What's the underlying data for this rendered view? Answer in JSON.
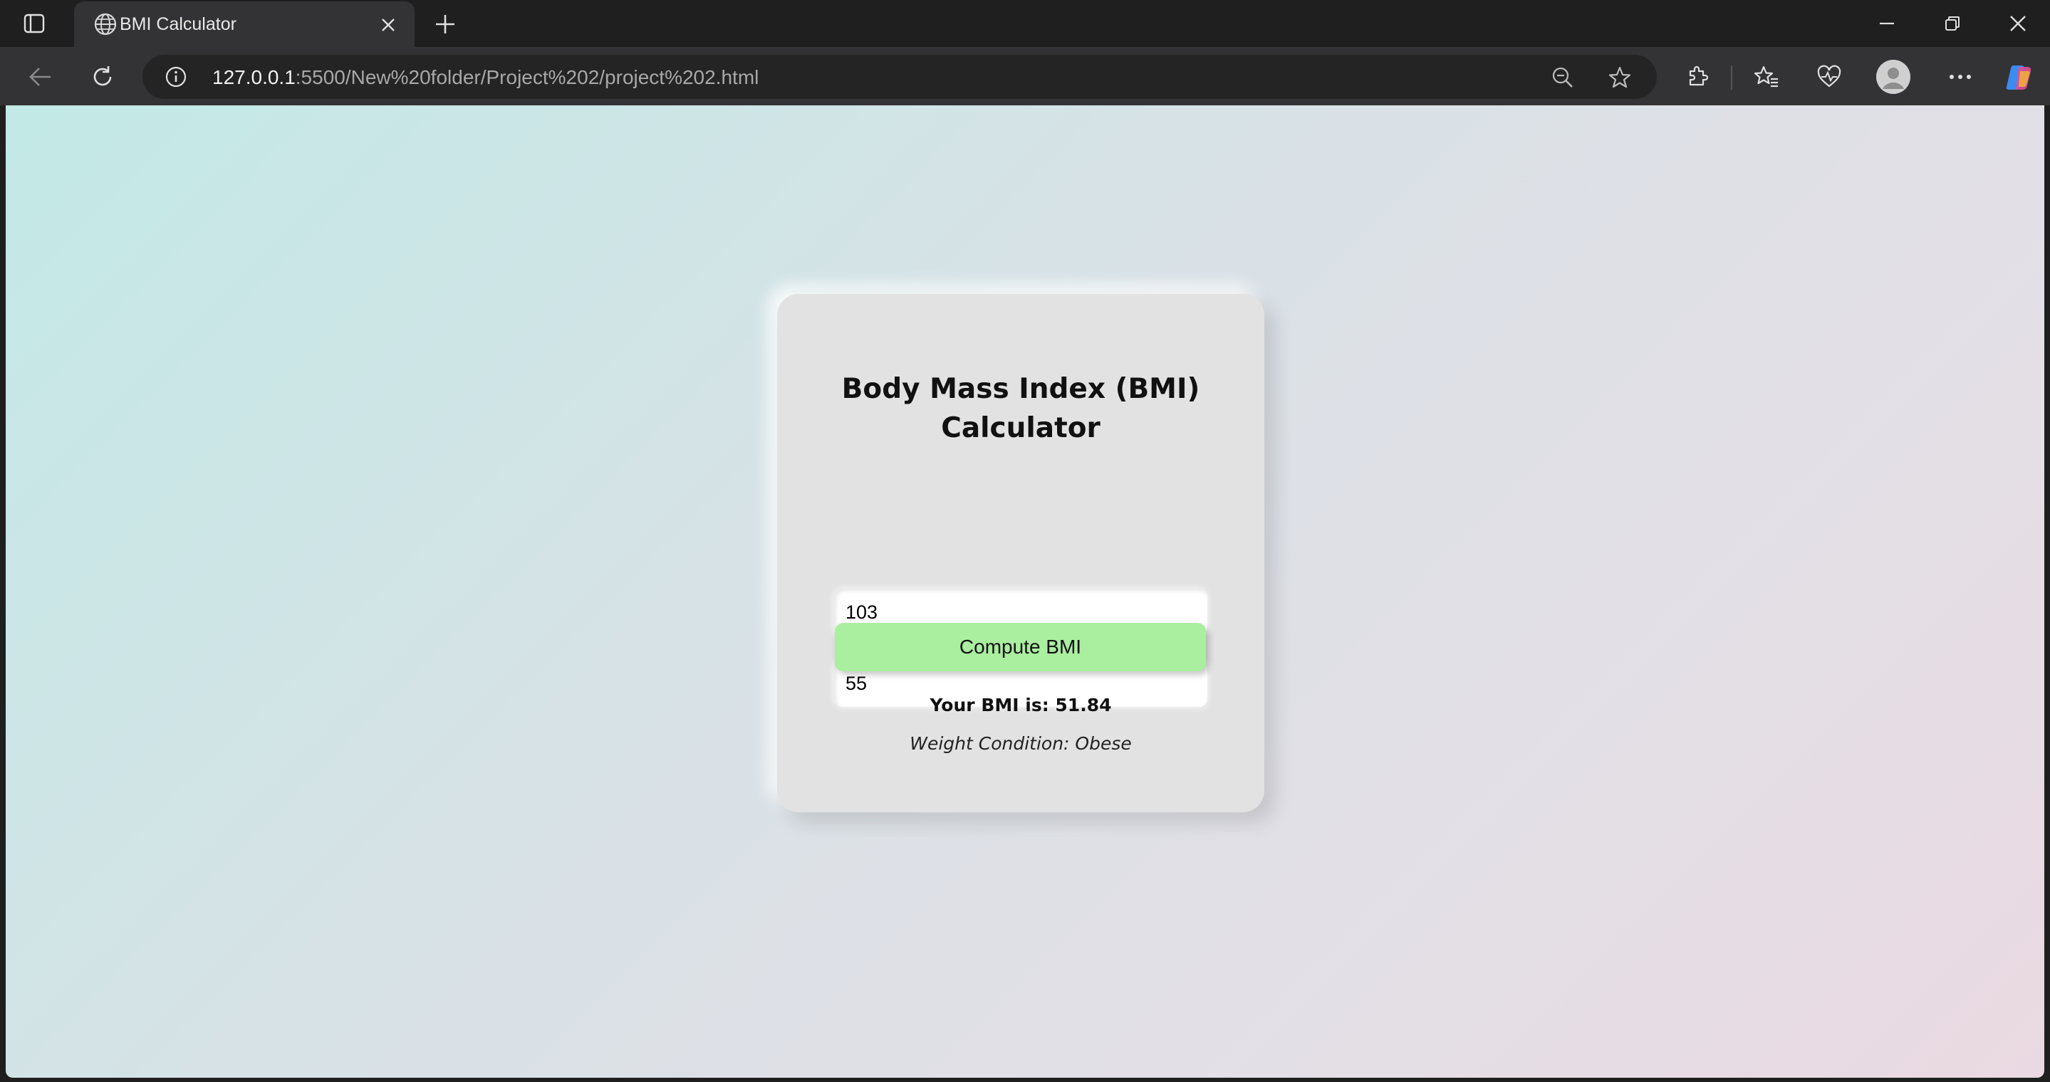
{
  "browser": {
    "tab": {
      "title": "BMI Calculator"
    },
    "address_bar": {
      "url_host": "127.0.0.1",
      "url_rest": ":5500/New%20folder/Project%202/project%202.html"
    }
  },
  "icons": [
    "tab-actions-icon",
    "globe-icon",
    "close-icon",
    "plus-icon",
    "minimize-icon",
    "restore-icon",
    "window-close-icon",
    "back-arrow-icon",
    "refresh-icon",
    "info-icon",
    "zoom-out-icon",
    "star-icon",
    "extensions-icon",
    "favorites-icon",
    "heart-pulse-icon",
    "profile-icon",
    "more-icon",
    "copilot-icon"
  ],
  "bmi_card": {
    "title": "Body Mass Index (BMI) Calculator",
    "weight_value": "103",
    "height_value": "55",
    "button_label": "Compute BMI",
    "result_text": "Your BMI is: 51.84",
    "condition_text": "Weight Condition: Obese",
    "button_color": "#aaeea0",
    "card_color": "#e2e2e2"
  }
}
